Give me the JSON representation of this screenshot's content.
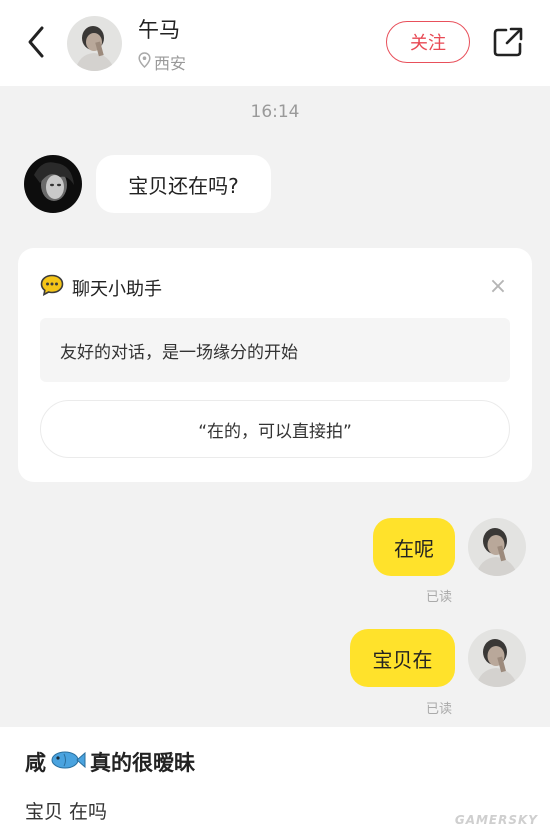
{
  "header": {
    "name": "午马",
    "location": "西安",
    "follow_label": "关注"
  },
  "chat": {
    "time": "16:14",
    "incoming_message": "宝贝还在吗?",
    "outgoing": [
      {
        "text": "在呢",
        "status": "已读"
      },
      {
        "text": "宝贝在",
        "status": "已读"
      }
    ]
  },
  "assistant": {
    "title": "聊天小助手",
    "message": "友好的对话，是一场缘分的开始",
    "suggested_reply": "“在的，可以直接拍”",
    "close_symbol": "×"
  },
  "caption": {
    "title_pre": "咸",
    "title_post": "真的很暧昧",
    "text": "宝贝 在吗"
  },
  "watermark": "GAMERSKY",
  "colors": {
    "accent_follow": "#e84a55",
    "bubble_outgoing": "#ffe22b",
    "bubble_incoming": "#ffffff",
    "assistant_icon": "#f5c518",
    "background": "#f2f2f2"
  },
  "icons": [
    "back-arrow-icon",
    "location-pin-icon",
    "share-icon",
    "chat-bubble-icon",
    "close-icon",
    "fish-emoji-icon"
  ]
}
